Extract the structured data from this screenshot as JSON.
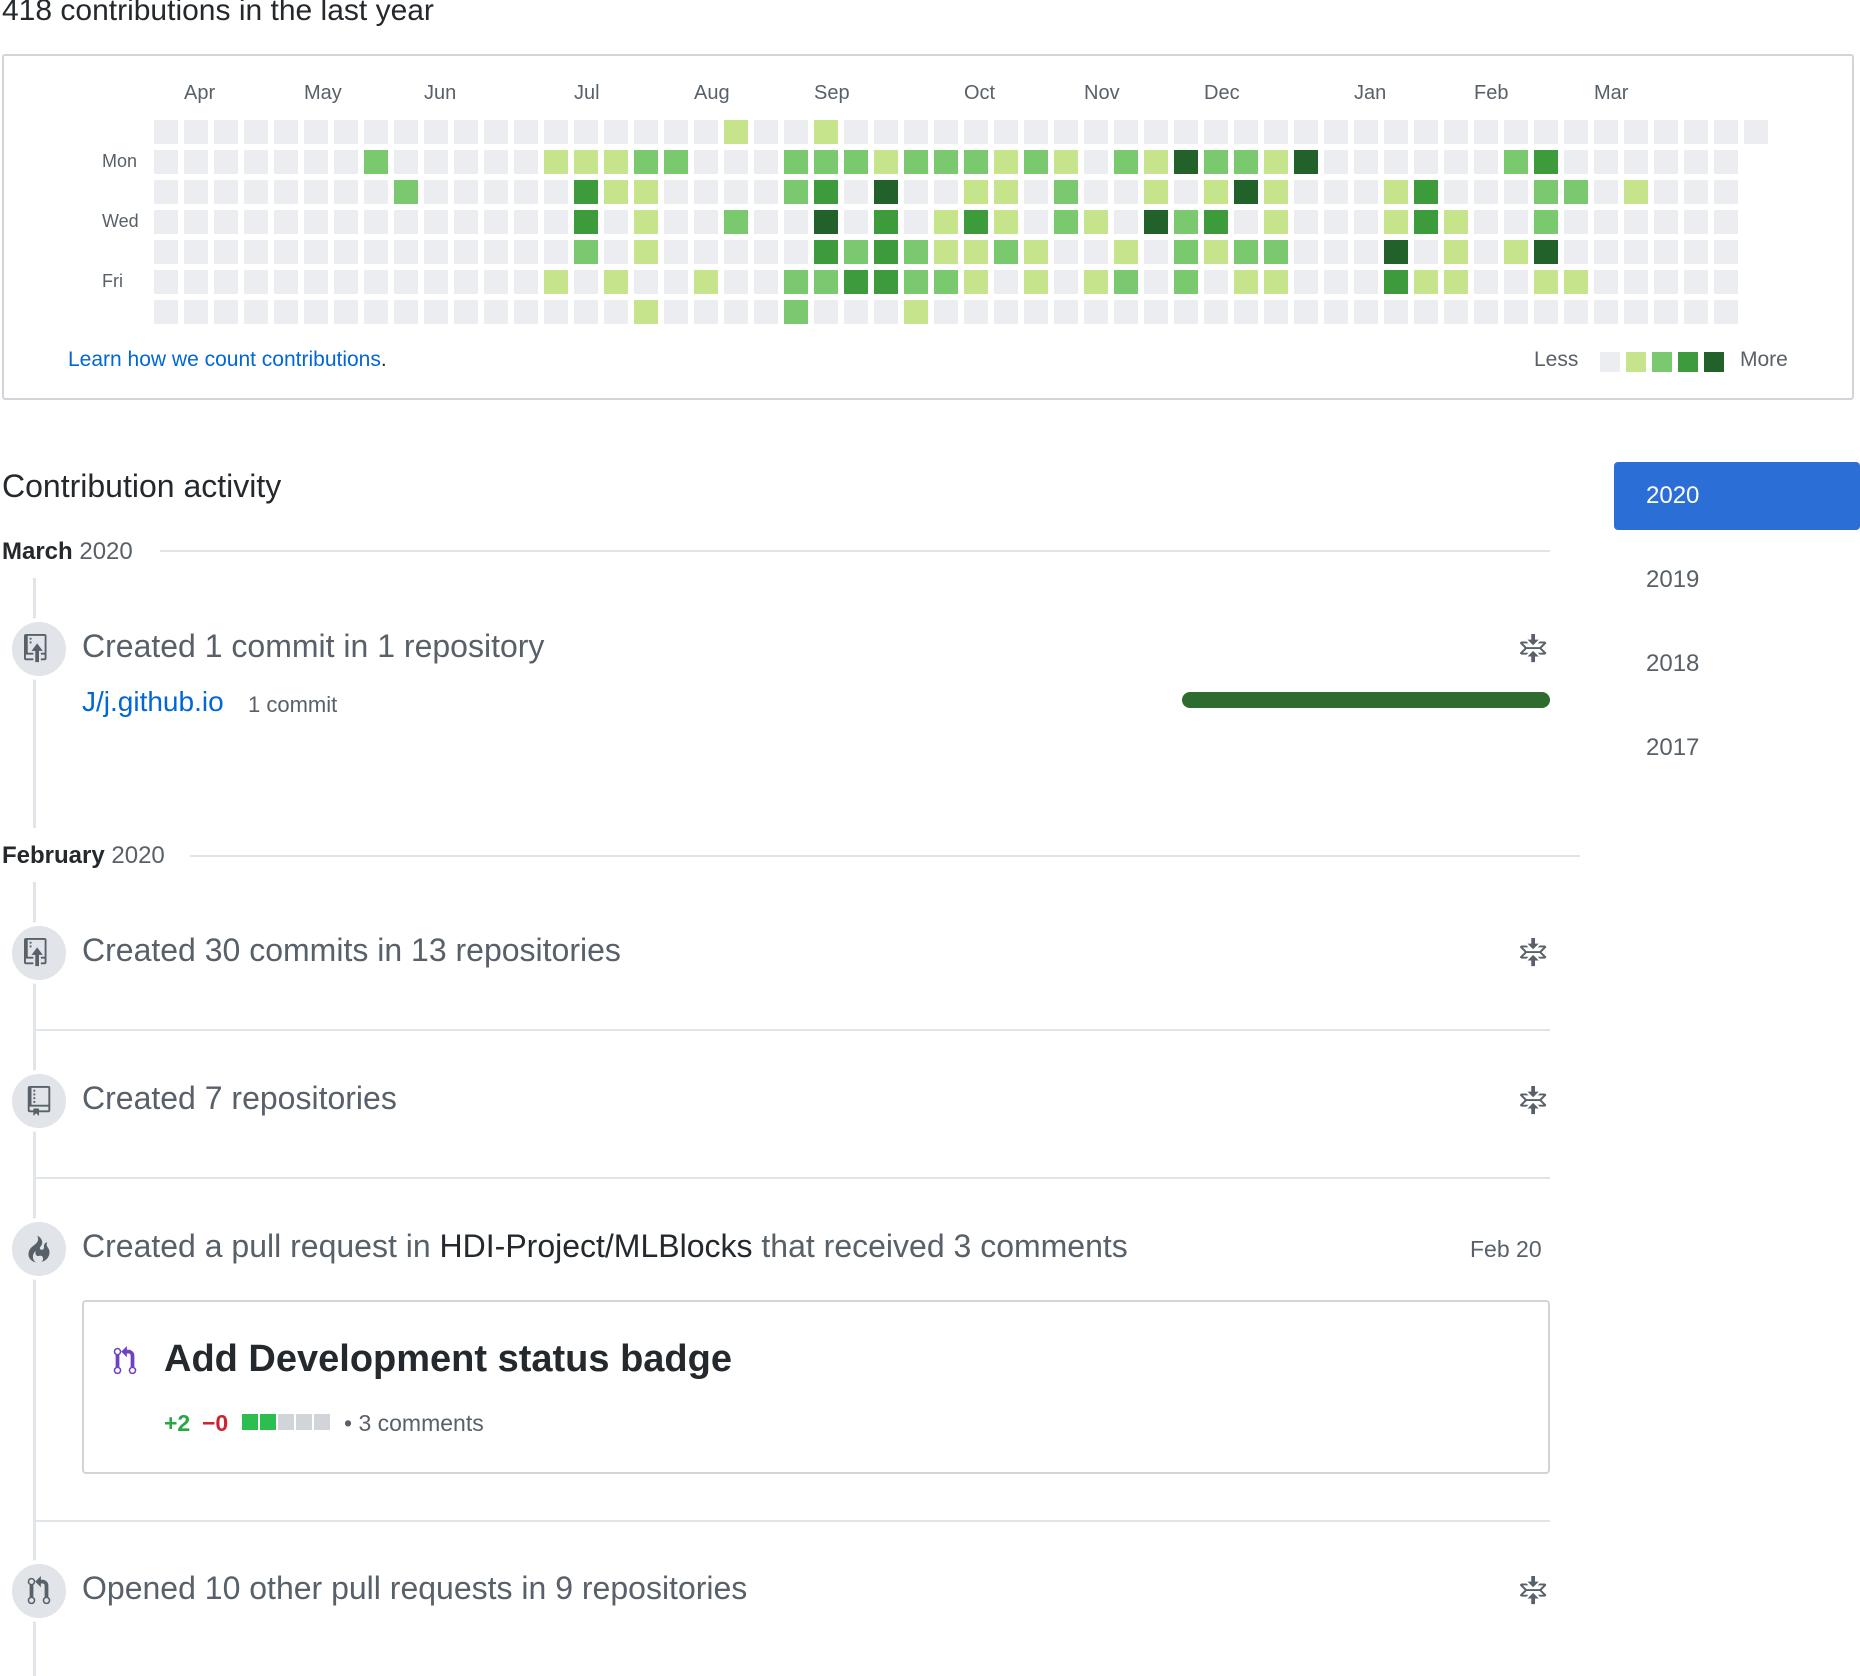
{
  "summary": "418 contributions in the last year",
  "calendar": {
    "months": [
      "Apr",
      "May",
      "Jun",
      "Jul",
      "Aug",
      "Sep",
      "Oct",
      "Nov",
      "Dec",
      "Jan",
      "Feb",
      "Mar"
    ],
    "day_labels": [
      "Mon",
      "Wed",
      "Fri"
    ],
    "colors": [
      "#ebedf0",
      "#c6e48b",
      "#7bc96f",
      "#3d9b3b",
      "#23612a"
    ],
    "weeks": [
      [
        0,
        0,
        0,
        0,
        0,
        0,
        0
      ],
      [
        0,
        0,
        0,
        0,
        0,
        0,
        0
      ],
      [
        0,
        0,
        0,
        0,
        0,
        0,
        0
      ],
      [
        0,
        0,
        0,
        0,
        0,
        0,
        0
      ],
      [
        0,
        0,
        0,
        0,
        0,
        0,
        0
      ],
      [
        0,
        0,
        0,
        0,
        0,
        0,
        0
      ],
      [
        0,
        0,
        0,
        0,
        0,
        0,
        0
      ],
      [
        0,
        2,
        0,
        0,
        0,
        0,
        0
      ],
      [
        0,
        0,
        2,
        0,
        0,
        0,
        0
      ],
      [
        0,
        0,
        0,
        0,
        0,
        0,
        0
      ],
      [
        0,
        0,
        0,
        0,
        0,
        0,
        0
      ],
      [
        0,
        0,
        0,
        0,
        0,
        0,
        0
      ],
      [
        0,
        0,
        0,
        0,
        0,
        0,
        0
      ],
      [
        0,
        1,
        0,
        0,
        0,
        1,
        0
      ],
      [
        0,
        1,
        3,
        3,
        2,
        0,
        0
      ],
      [
        0,
        1,
        1,
        0,
        0,
        1,
        0
      ],
      [
        0,
        2,
        1,
        1,
        1,
        0,
        1
      ],
      [
        0,
        2,
        0,
        0,
        0,
        0,
        0
      ],
      [
        0,
        0,
        0,
        0,
        0,
        1,
        0
      ],
      [
        1,
        0,
        0,
        2,
        0,
        0,
        0
      ],
      [
        0,
        0,
        0,
        0,
        0,
        0,
        0
      ],
      [
        0,
        2,
        2,
        0,
        0,
        2,
        2
      ],
      [
        1,
        2,
        3,
        4,
        3,
        2,
        0
      ],
      [
        0,
        2,
        0,
        0,
        2,
        3,
        0
      ],
      [
        0,
        1,
        4,
        3,
        3,
        3,
        0
      ],
      [
        0,
        2,
        0,
        0,
        2,
        2,
        1
      ],
      [
        0,
        2,
        0,
        1,
        1,
        2,
        0
      ],
      [
        0,
        2,
        1,
        3,
        1,
        1,
        0
      ],
      [
        0,
        1,
        1,
        1,
        2,
        0,
        0
      ],
      [
        0,
        2,
        0,
        0,
        1,
        1,
        0
      ],
      [
        0,
        1,
        2,
        2,
        0,
        0,
        0
      ],
      [
        0,
        0,
        0,
        1,
        0,
        1,
        0
      ],
      [
        0,
        2,
        0,
        0,
        1,
        2,
        0
      ],
      [
        0,
        1,
        1,
        4,
        0,
        0,
        0
      ],
      [
        0,
        4,
        0,
        2,
        2,
        2,
        0
      ],
      [
        0,
        2,
        1,
        3,
        1,
        0,
        0
      ],
      [
        0,
        2,
        4,
        0,
        2,
        1,
        0
      ],
      [
        0,
        1,
        1,
        1,
        2,
        1,
        0
      ],
      [
        0,
        4,
        0,
        0,
        0,
        0,
        0
      ],
      [
        0,
        0,
        0,
        0,
        0,
        0,
        0
      ],
      [
        0,
        0,
        0,
        0,
        0,
        0,
        0
      ],
      [
        0,
        0,
        1,
        1,
        4,
        3,
        0
      ],
      [
        0,
        0,
        3,
        3,
        0,
        1,
        0
      ],
      [
        0,
        0,
        0,
        1,
        1,
        1,
        0
      ],
      [
        0,
        0,
        0,
        0,
        0,
        0,
        0
      ],
      [
        0,
        2,
        0,
        0,
        1,
        0,
        0
      ],
      [
        0,
        3,
        2,
        2,
        4,
        1,
        0
      ],
      [
        0,
        0,
        2,
        0,
        0,
        1,
        0
      ],
      [
        0,
        0,
        0,
        0,
        0,
        0,
        0
      ],
      [
        0,
        0,
        1,
        0,
        0,
        0,
        0
      ],
      [
        0,
        0,
        0,
        0,
        0,
        0,
        0
      ],
      [
        0,
        0,
        0,
        0,
        0,
        0,
        0
      ],
      [
        0,
        0,
        0,
        0,
        0,
        0,
        0
      ],
      [
        0
      ]
    ],
    "learn_link": "Learn how we count contributions",
    "learn_dot": ".",
    "less": "Less",
    "more": "More"
  },
  "activity": {
    "title": "Contribution activity",
    "years": [
      "2020",
      "2019",
      "2018",
      "2017"
    ],
    "selected_year": "2020",
    "sections": [
      {
        "month": "March",
        "year": "2020"
      },
      {
        "month": "February",
        "year": "2020"
      }
    ],
    "march_commit": {
      "title": "Created 1 commit in 1 repository",
      "repo": "J/j.github.io",
      "count": "1 commit"
    },
    "feb": {
      "commits_title": "Created 30 commits in 13 repositories",
      "repos_title": "Created 7 repositories",
      "pr_prefix": "Created a pull request in ",
      "pr_repo": "HDI-Project/MLBlocks",
      "pr_suffix": " that received 3 comments",
      "pr_date": "Feb 20",
      "pr_card_title": "Add Development status badge",
      "pr_additions": "+2",
      "pr_deletions": "−0",
      "pr_diff_blocks": [
        "added",
        "added",
        "neutral",
        "neutral",
        "neutral"
      ],
      "pr_comments": "• 3 comments",
      "opened_title": "Opened 10 other pull requests in 9 repositories"
    }
  }
}
